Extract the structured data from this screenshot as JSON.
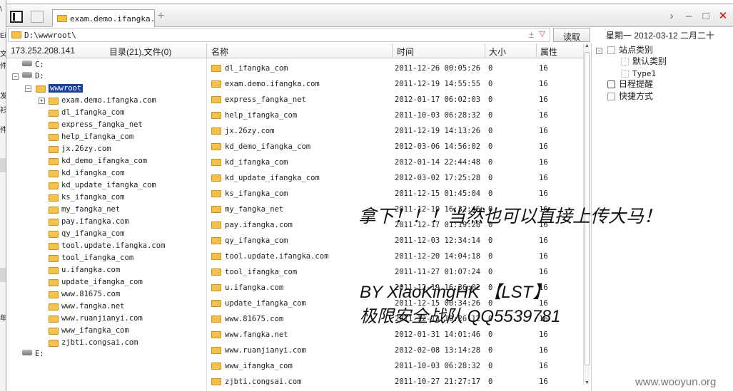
{
  "window": {
    "tab_title": "exam.demo.ifangka...",
    "new_tab": "+",
    "left_strip_chars": [
      "\\",
      "Ei",
      "文",
      "件",
      "发",
      "衫",
      "件",
      "年"
    ]
  },
  "address": {
    "path": "D:\\wwwroot\\",
    "plus": "±",
    "go_label": "读取",
    "date_text": "星期一 2012-03-12 二月二十"
  },
  "header": {
    "ip": "173.252.208.141",
    "dir_info": "目录(21),文件(0)",
    "col_name": "名称",
    "col_time": "时间",
    "col_size": "大小",
    "col_attr": "属性"
  },
  "tree": {
    "drive_c": "C:",
    "drive_d": "D:",
    "selected": "wwwroot",
    "folders": [
      "exam.demo.ifangka.com",
      "dl_ifangka_com",
      "express_fangka_net",
      "help_ifangka_com",
      "jx.26zy.com",
      "kd_demo_ifangka_com",
      "kd_ifangka_com",
      "kd_update_ifangka_com",
      "ks_ifangka_com",
      "my_fangka_net",
      "pay.ifangka.com",
      "qy_ifangka_com",
      "tool.update.ifangka.com",
      "tool_ifangka_com",
      "u.ifangka.com",
      "update_ifangka_com",
      "www.81675.com",
      "www.fangka.net",
      "www.ruanjianyi.com",
      "www_ifangka_com",
      "zjbti.congsai.com"
    ],
    "drive_e": "E:"
  },
  "files": [
    {
      "name": "dl_ifangka_com",
      "time": "2011-12-26 00:05:26",
      "size": "0",
      "attr": "16"
    },
    {
      "name": "exam.demo.ifangka.com",
      "time": "2011-12-19 14:55:55",
      "size": "0",
      "attr": "16"
    },
    {
      "name": "express_fangka_net",
      "time": "2012-01-17 06:02:03",
      "size": "0",
      "attr": "16"
    },
    {
      "name": "help_ifangka_com",
      "time": "2011-10-03 06:28:32",
      "size": "0",
      "attr": "16"
    },
    {
      "name": "jx.26zy.com",
      "time": "2011-12-19 14:13:26",
      "size": "0",
      "attr": "16"
    },
    {
      "name": "kd_demo_ifangka_com",
      "time": "2012-03-06 14:56:02",
      "size": "0",
      "attr": "16"
    },
    {
      "name": "kd_ifangka_com",
      "time": "2012-01-14 22:44:48",
      "size": "0",
      "attr": "16"
    },
    {
      "name": "kd_update_ifangka_com",
      "time": "2012-03-02 17:25:28",
      "size": "0",
      "attr": "16"
    },
    {
      "name": "ks_ifangka_com",
      "time": "2011-12-15 01:45:04",
      "size": "0",
      "attr": "16"
    },
    {
      "name": "my_fangka_net",
      "time": "2011-12-19 16:32:46",
      "size": "0",
      "attr": "16"
    },
    {
      "name": "pay.ifangka.com",
      "time": "2011-12-17 01:19:28",
      "size": "0",
      "attr": "16"
    },
    {
      "name": "qy_ifangka_com",
      "time": "2011-12-03 12:34:14",
      "size": "0",
      "attr": "16"
    },
    {
      "name": "tool.update.ifangka.com",
      "time": "2011-12-20 14:04:18",
      "size": "0",
      "attr": "16"
    },
    {
      "name": "tool_ifangka_com",
      "time": "2011-11-27 01:07:24",
      "size": "0",
      "attr": "16"
    },
    {
      "name": "u.ifangka.com",
      "time": "2011-12-19 16:36:02",
      "size": "0",
      "attr": "16"
    },
    {
      "name": "update_ifangka_com",
      "time": "2011-12-15 00:34:26",
      "size": "0",
      "attr": "16"
    },
    {
      "name": "www.81675.com",
      "time": "2011-12-13 10:26:12",
      "size": "0",
      "attr": "16"
    },
    {
      "name": "www.fangka.net",
      "time": "2012-01-31 14:01:46",
      "size": "0",
      "attr": "16"
    },
    {
      "name": "www.ruanjianyi.com",
      "time": "2012-02-08 13:14:28",
      "size": "0",
      "attr": "16"
    },
    {
      "name": "www_ifangka_com",
      "time": "2011-10-03 06:28:32",
      "size": "0",
      "attr": "16"
    },
    {
      "name": "zjbti.congsai.com",
      "time": "2011-10-27 21:27:17",
      "size": "0",
      "attr": "16"
    }
  ],
  "right_panel": {
    "site_category": "站点类别",
    "default_category": "默认类别",
    "type1": "Type1",
    "schedule": "日程提醒",
    "shortcut": "快捷方式"
  },
  "overlay": {
    "line1": "拿下！！！当然也可以直接上传大马！",
    "line2": "BY XiaoKingHK 【LST】",
    "line3": "极限安全战队      QQ5539781"
  },
  "watermark": "www.wooyun.org"
}
